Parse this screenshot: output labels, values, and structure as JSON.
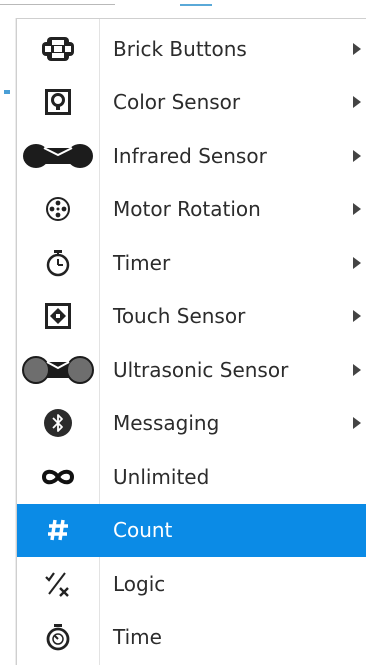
{
  "menu": {
    "items": [
      {
        "label": "Brick Buttons",
        "icon": "brick-buttons-icon",
        "has_submenu": true
      },
      {
        "label": "Color Sensor",
        "icon": "color-sensor-icon",
        "has_submenu": true
      },
      {
        "label": "Infrared Sensor",
        "icon": "infrared-sensor-icon",
        "has_submenu": true
      },
      {
        "label": "Motor Rotation",
        "icon": "motor-rotation-icon",
        "has_submenu": true
      },
      {
        "label": "Timer",
        "icon": "timer-icon",
        "has_submenu": true
      },
      {
        "label": "Touch Sensor",
        "icon": "touch-sensor-icon",
        "has_submenu": true
      },
      {
        "label": "Ultrasonic Sensor",
        "icon": "ultrasonic-sensor-icon",
        "has_submenu": true
      },
      {
        "label": "Messaging",
        "icon": "bluetooth-icon",
        "has_submenu": true
      },
      {
        "label": "Unlimited",
        "icon": "infinity-icon",
        "has_submenu": false
      },
      {
        "label": "Count",
        "icon": "hash-icon",
        "has_submenu": false
      },
      {
        "label": "Logic",
        "icon": "logic-icon",
        "has_submenu": false
      },
      {
        "label": "Time",
        "icon": "time-icon",
        "has_submenu": false
      }
    ],
    "selected": "Count",
    "colors": {
      "selected_bg": "#0b8be6",
      "text": "#2c2c2c",
      "selected_text": "#ffffff"
    }
  }
}
